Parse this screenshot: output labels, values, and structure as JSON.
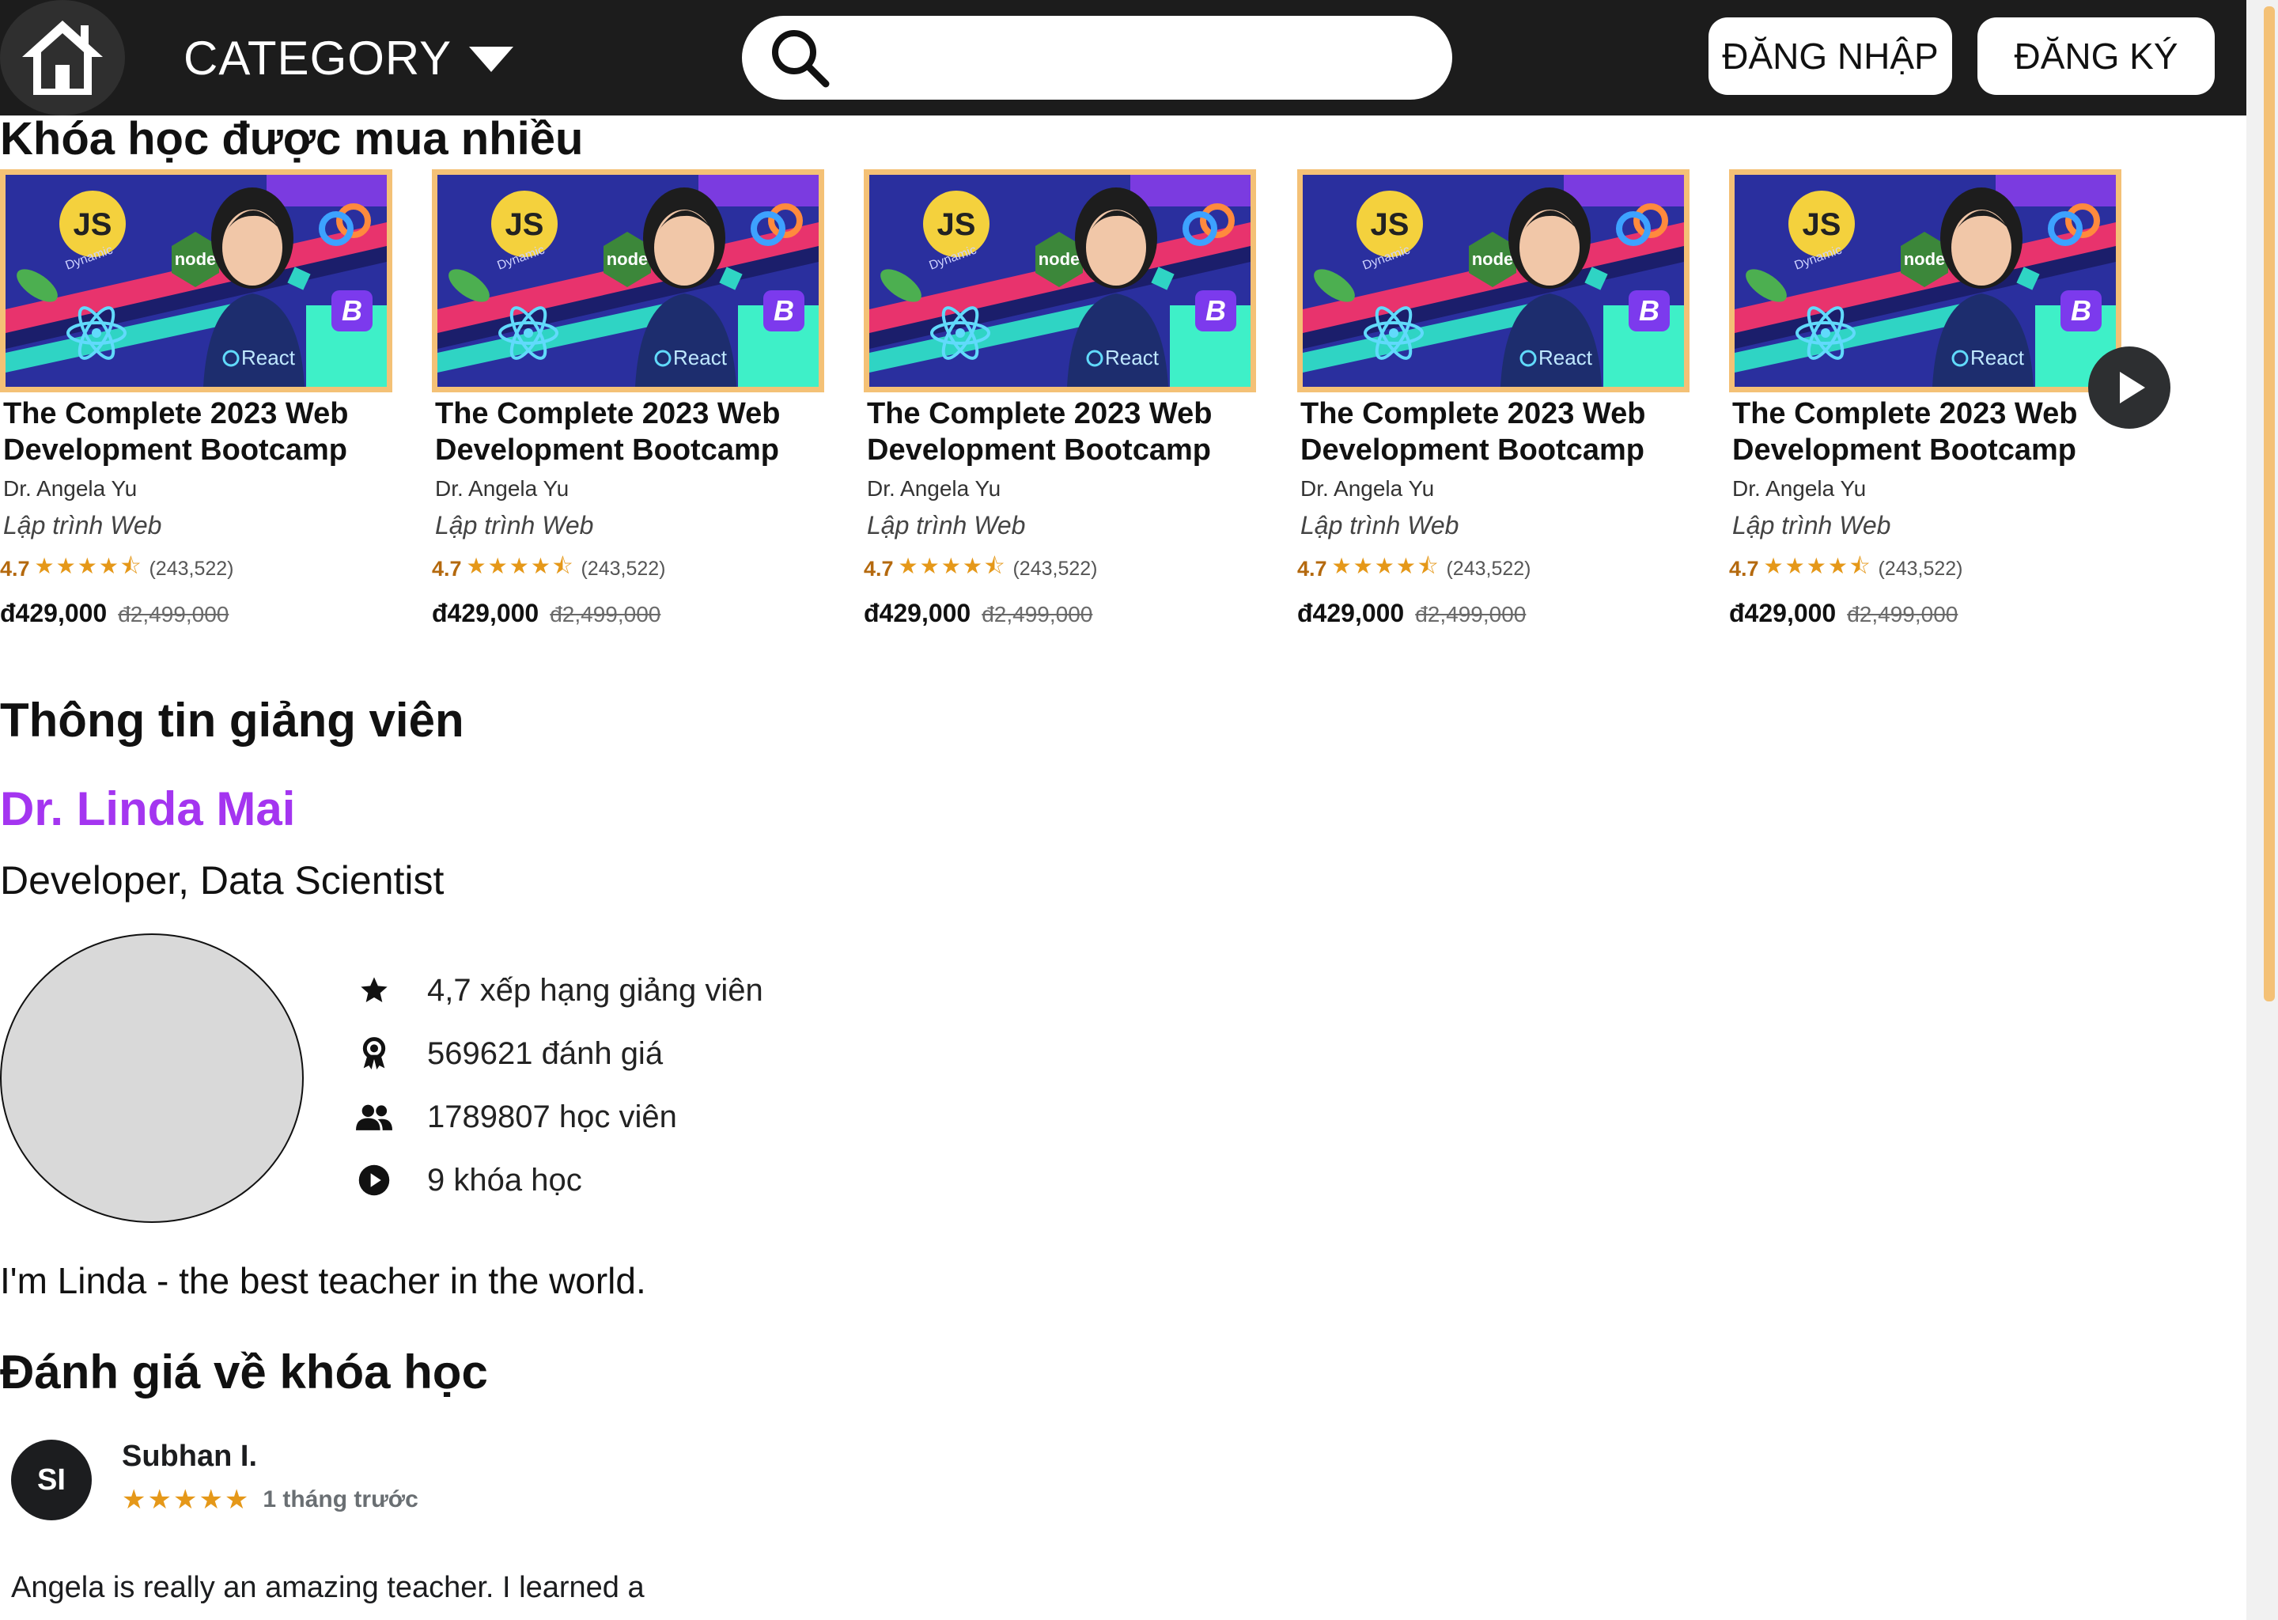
{
  "header": {
    "home_icon": "home-icon",
    "category_label": "CATEGORY",
    "search_placeholder": "",
    "login_label": "ĐĂNG NHẬP",
    "register_label": "ĐĂNG KÝ"
  },
  "popular": {
    "title": "Khóa học được mua nhiều",
    "courses": [
      {
        "title": "The Complete 2023 Web Development Bootcamp",
        "author": "Dr. Angela Yu",
        "category": "Lập trình Web",
        "rating": "4.7",
        "stars": "★★★★⯪",
        "rating_count": "(243,522)",
        "price": "đ429,000",
        "old_price": "đ2,499,000"
      },
      {
        "title": "The Complete 2023 Web Development Bootcamp",
        "author": "Dr. Angela Yu",
        "category": "Lập trình Web",
        "rating": "4.7",
        "stars": "★★★★⯪",
        "rating_count": "(243,522)",
        "price": "đ429,000",
        "old_price": "đ2,499,000"
      },
      {
        "title": "The Complete 2023 Web Development Bootcamp",
        "author": "Dr. Angela Yu",
        "category": "Lập trình Web",
        "rating": "4.7",
        "stars": "★★★★⯪",
        "rating_count": "(243,522)",
        "price": "đ429,000",
        "old_price": "đ2,499,000"
      },
      {
        "title": "The Complete 2023 Web Development Bootcamp",
        "author": "Dr. Angela Yu",
        "category": "Lập trình Web",
        "rating": "4.7",
        "stars": "★★★★⯪",
        "rating_count": "(243,522)",
        "price": "đ429,000",
        "old_price": "đ2,499,000"
      },
      {
        "title": "The Complete 2023 Web Development Bootcamp",
        "author": "Dr. Angela Yu",
        "category": "Lập trình Web",
        "rating": "4.7",
        "stars": "★★★★⯪",
        "rating_count": "(243,522)",
        "price": "đ429,000",
        "old_price": "đ2,499,000"
      }
    ],
    "thumbnail_labels": {
      "js": "JS",
      "dynamic": "Dynamic",
      "node": "node",
      "react": "React",
      "bootstrap": "B"
    }
  },
  "instructor": {
    "section_title": "Thông tin giảng viên",
    "name": "Dr. Linda Mai",
    "role": "Developer, Data Scientist",
    "stats": [
      {
        "icon": "star-icon",
        "text": "4,7 xếp hạng giảng viên"
      },
      {
        "icon": "award-icon",
        "text": "569621 đánh giá"
      },
      {
        "icon": "people-icon",
        "text": "1789807 học viên"
      },
      {
        "icon": "play-circle-icon",
        "text": "9 khóa học"
      }
    ],
    "bio": "I'm Linda - the best teacher in the world."
  },
  "reviews": {
    "section_title": "Đánh giá về khóa học",
    "items": [
      {
        "initials": "SI",
        "name": "Subhan I.",
        "stars": "★★★★★",
        "date": "1 tháng trước",
        "text": "Angela is really an amazing teacher. I learned a"
      }
    ]
  },
  "colors": {
    "header_bg": "#1c1c1c",
    "instructor_name": "#a435f0",
    "rating_orange": "#b4690e",
    "star_gold": "#e59819",
    "thumb_border": "#f4c176"
  }
}
